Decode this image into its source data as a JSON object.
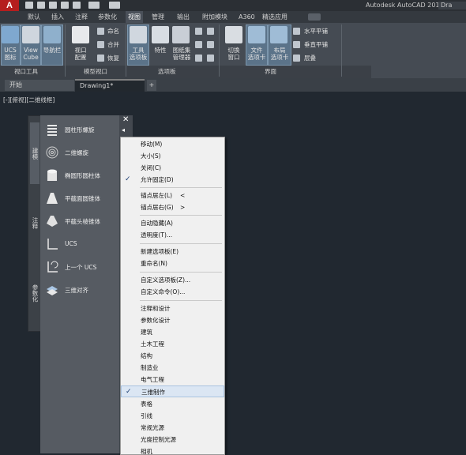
{
  "window": {
    "title": "Autodesk AutoCAD 2018",
    "title_tail": "Dra"
  },
  "app_logo": "A",
  "ribbon_tabs": [
    "默认",
    "插入",
    "注释",
    "参数化",
    "视图",
    "管理",
    "输出",
    "附加模块",
    "A360",
    "精选应用"
  ],
  "active_tab": "视图",
  "ribbon": {
    "viewport_tools": {
      "ucs_icon": "UCS\n图标",
      "viewcube": "View\nCube",
      "navbar": "导航栏",
      "title": "视口工具"
    },
    "model_viewports": {
      "viewport_config": "视口\n配置",
      "named": "命名",
      "join": "合并",
      "restore": "恢复",
      "title": "模型视口"
    },
    "palettes": {
      "tool_palette": "工具\n选项板",
      "properties": "特性",
      "sheet_set": "图纸集\n管理器",
      "title": "选项板"
    },
    "interface": {
      "switch_window": "切换\n窗口",
      "file_tabs": "文件\n选项卡",
      "layout_tabs": "布局\n选项卡",
      "tile_h": "水平平铺",
      "tile_v": "垂直平铺",
      "cascade": "层叠",
      "title": "界面"
    }
  },
  "file_tabs": {
    "start": "开始",
    "drawing": "Drawing1*"
  },
  "viewport_label": "[-][俯视][二维线框]",
  "palette": {
    "vertical_tabs": [
      "建模",
      "注释",
      "参数化"
    ],
    "close": "✕",
    "tools": [
      {
        "label": "圆柱形螺旋",
        "icon": "helix-icon"
      },
      {
        "label": "二维螺旋",
        "icon": "spiral-icon"
      },
      {
        "label": "椭圆形圆柱体",
        "icon": "elliptic-cylinder-icon"
      },
      {
        "label": "平截面圆锥体",
        "icon": "frustum-cone-icon"
      },
      {
        "label": "平截头棱锥体",
        "icon": "frustum-pyramid-icon"
      },
      {
        "label": "UCS",
        "icon": "ucs-icon"
      },
      {
        "label": "上一个 UCS",
        "icon": "ucs-previous-icon"
      },
      {
        "label": "三维对齐",
        "icon": "3d-align-icon"
      }
    ]
  },
  "context_menu": {
    "items": [
      {
        "label": "移动(M)"
      },
      {
        "label": "大小(S)"
      },
      {
        "label": "关闭(C)"
      },
      {
        "label": "允许固定(D)",
        "checked": true
      },
      {
        "label": "锚点居左(L)",
        "arrow": "<"
      },
      {
        "label": "锚点居右(G)",
        "arrow": ">"
      },
      {
        "label": "自动隐藏(A)"
      },
      {
        "label": "透明度(T)..."
      },
      {
        "label": "新建选项板(E)"
      },
      {
        "label": "重命名(N)"
      },
      {
        "label": "自定义选项板(Z)..."
      },
      {
        "label": "自定义命令(O)..."
      },
      {
        "label": "注释和设计"
      },
      {
        "label": "参数化设计"
      },
      {
        "label": "建筑"
      },
      {
        "label": "土木工程"
      },
      {
        "label": "结构"
      },
      {
        "label": "制造业"
      },
      {
        "label": "电气工程"
      },
      {
        "label": "三维制作",
        "checked": true,
        "highlighted": true
      },
      {
        "label": "表格"
      },
      {
        "label": "引线"
      },
      {
        "label": "常规光源"
      },
      {
        "label": "光度控制光源"
      },
      {
        "label": "相机"
      }
    ]
  },
  "colors": {
    "accent": "#b51e1e",
    "canvas": "#212830",
    "ribbon": "#454b53",
    "menu_bg": "#f0f0f0",
    "highlight": "#dbe6f3"
  }
}
